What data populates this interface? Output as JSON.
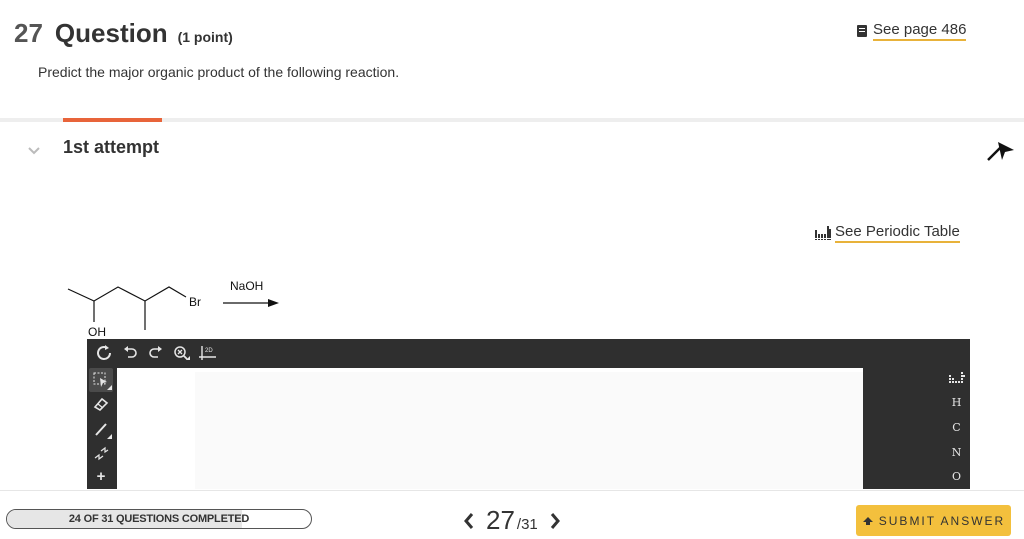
{
  "question": {
    "number": "27",
    "title": "Question",
    "points": "(1 point)",
    "prompt": "Predict the major organic product of the following reaction.",
    "see_page": "See page 486"
  },
  "attempt": {
    "label": "1st attempt"
  },
  "periodic_table_link": "See Periodic Table",
  "reaction": {
    "reactant_labels": [
      "OH",
      "Br"
    ],
    "reagent": "NaOH"
  },
  "editor": {
    "top_tools": [
      {
        "icon": "ring-icon"
      },
      {
        "icon": "undo-icon"
      },
      {
        "icon": "redo-icon"
      },
      {
        "icon": "zoom-icon"
      },
      {
        "icon": "2d-view-icon",
        "label": "2D"
      }
    ],
    "left_tools": [
      {
        "icon": "selection-icon",
        "selected": true
      },
      {
        "icon": "eraser-icon"
      },
      {
        "icon": "bond-icon"
      },
      {
        "icon": "chain-icon"
      },
      {
        "icon": "charge-plus-icon",
        "label": "+"
      }
    ],
    "atoms": [
      "H",
      "C",
      "N",
      "O"
    ]
  },
  "footer": {
    "progress_text": "24 OF 31 QUESTIONS COMPLETED",
    "progress_fraction": 0.774,
    "current_page": "27",
    "total_pages": "/31",
    "submit_label": "SUBMIT ANSWER"
  },
  "colors": {
    "accent_orange": "#e8643a",
    "link_underline": "#e8b23a",
    "submit_yellow": "#f3c03d",
    "editor_dark": "#2f2f2f"
  }
}
